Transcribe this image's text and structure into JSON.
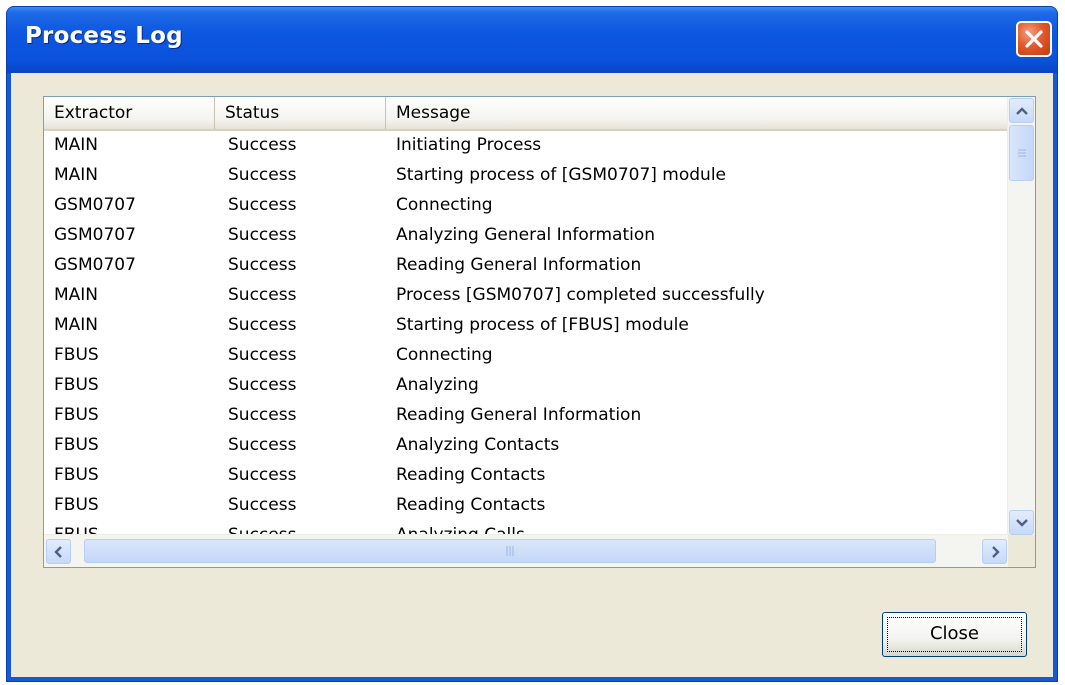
{
  "window": {
    "title": "Process Log"
  },
  "columns": [
    "Extractor",
    "Status",
    "Message"
  ],
  "rows": [
    {
      "extractor": "MAIN",
      "status": "Success",
      "message": "Initiating Process"
    },
    {
      "extractor": "MAIN",
      "status": "Success",
      "message": "Starting process of [GSM0707] module"
    },
    {
      "extractor": "GSM0707",
      "status": "Success",
      "message": "Connecting"
    },
    {
      "extractor": "GSM0707",
      "status": "Success",
      "message": "Analyzing General Information"
    },
    {
      "extractor": "GSM0707",
      "status": "Success",
      "message": "Reading General Information"
    },
    {
      "extractor": "MAIN",
      "status": "Success",
      "message": "Process [GSM0707] completed successfully"
    },
    {
      "extractor": "MAIN",
      "status": "Success",
      "message": "Starting process of [FBUS] module"
    },
    {
      "extractor": "FBUS",
      "status": "Success",
      "message": "Connecting"
    },
    {
      "extractor": "FBUS",
      "status": "Success",
      "message": "Analyzing"
    },
    {
      "extractor": "FBUS",
      "status": "Success",
      "message": "Reading General Information"
    },
    {
      "extractor": "FBUS",
      "status": "Success",
      "message": "Analyzing Contacts"
    },
    {
      "extractor": "FBUS",
      "status": "Success",
      "message": "Reading Contacts"
    },
    {
      "extractor": "FBUS",
      "status": "Success",
      "message": "Reading Contacts"
    },
    {
      "extractor": "FBUS",
      "status": "Success",
      "message": "Analyzing Calls"
    }
  ],
  "buttons": {
    "close_label": "Close"
  },
  "icons": {
    "title_close": "close-x-icon",
    "scroll_up": "chevron-up-icon",
    "scroll_down": "chevron-down-icon",
    "scroll_left": "chevron-left-icon",
    "scroll_right": "chevron-right-icon"
  },
  "colors": {
    "titlebar": "#0a52dc",
    "client": "#ece9d8",
    "close_button": "#e2592d",
    "scrollbar": "#c5d7f8"
  }
}
